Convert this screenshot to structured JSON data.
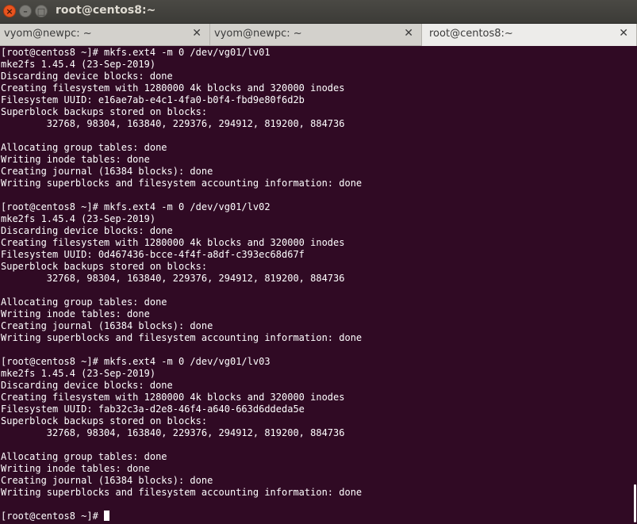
{
  "window": {
    "title": "root@centos8:~",
    "buttons": {
      "close": "×",
      "minimize": "–",
      "maximize": "□"
    }
  },
  "tabs": [
    {
      "label": "vyom@newpc: ~",
      "close": "✕",
      "active": false
    },
    {
      "label": "vyom@newpc: ~",
      "close": "✕",
      "active": false
    },
    {
      "label": "root@centos8:~",
      "close": "✕",
      "active": true
    }
  ],
  "terminal": {
    "lines": [
      "[root@centos8 ~]# mkfs.ext4 -m 0 /dev/vg01/lv01",
      "mke2fs 1.45.4 (23-Sep-2019)",
      "Discarding device blocks: done",
      "Creating filesystem with 1280000 4k blocks and 320000 inodes",
      "Filesystem UUID: e16ae7ab-e4c1-4fa0-b0f4-fbd9e80f6d2b",
      "Superblock backups stored on blocks:",
      "        32768, 98304, 163840, 229376, 294912, 819200, 884736",
      "",
      "Allocating group tables: done",
      "Writing inode tables: done",
      "Creating journal (16384 blocks): done",
      "Writing superblocks and filesystem accounting information: done",
      "",
      "[root@centos8 ~]# mkfs.ext4 -m 0 /dev/vg01/lv02",
      "mke2fs 1.45.4 (23-Sep-2019)",
      "Discarding device blocks: done",
      "Creating filesystem with 1280000 4k blocks and 320000 inodes",
      "Filesystem UUID: 0d467436-bcce-4f4f-a8df-c393ec68d67f",
      "Superblock backups stored on blocks:",
      "        32768, 98304, 163840, 229376, 294912, 819200, 884736",
      "",
      "Allocating group tables: done",
      "Writing inode tables: done",
      "Creating journal (16384 blocks): done",
      "Writing superblocks and filesystem accounting information: done",
      "",
      "[root@centos8 ~]# mkfs.ext4 -m 0 /dev/vg01/lv03",
      "mke2fs 1.45.4 (23-Sep-2019)",
      "Discarding device blocks: done",
      "Creating filesystem with 1280000 4k blocks and 320000 inodes",
      "Filesystem UUID: fab32c3a-d2e8-46f4-a640-663d6ddeda5e",
      "Superblock backups stored on blocks:",
      "        32768, 98304, 163840, 229376, 294912, 819200, 884736",
      "",
      "Allocating group tables: done",
      "Writing inode tables: done",
      "Creating journal (16384 blocks): done",
      "Writing superblocks and filesystem accounting information: done",
      ""
    ],
    "prompt": "[root@centos8 ~]# "
  },
  "colors": {
    "terminal_bg": "#300a24",
    "terminal_fg": "#ffffff",
    "close_button": "#e9541f",
    "titlebar": "#3c3b37"
  }
}
